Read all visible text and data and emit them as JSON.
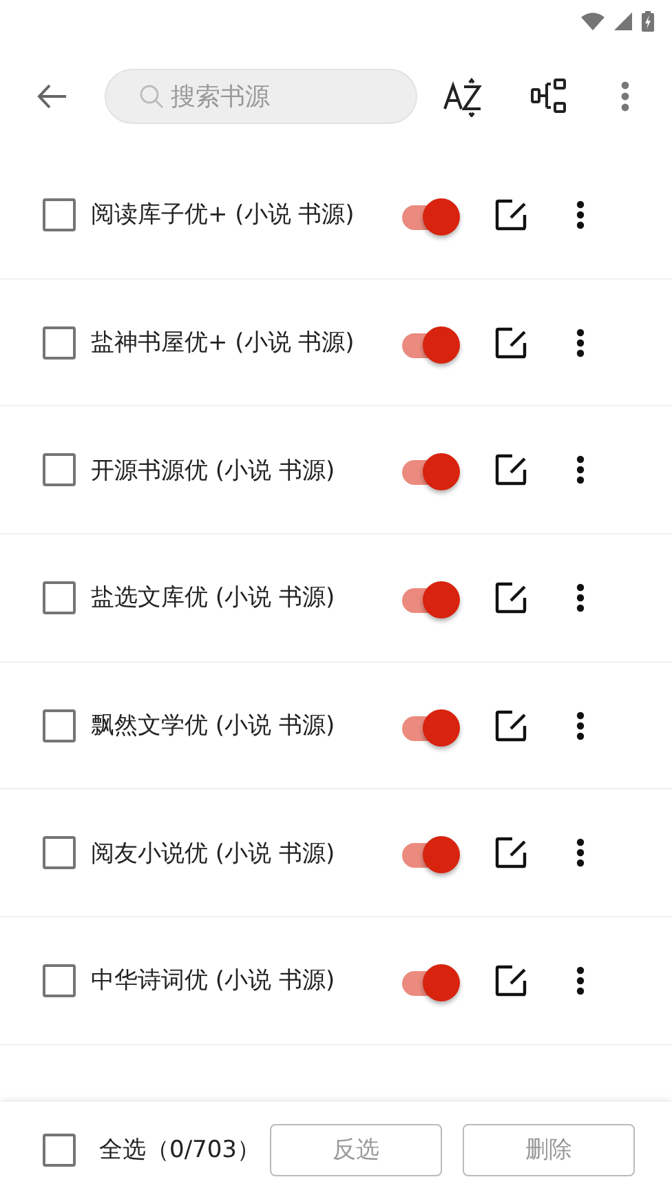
{
  "toolbar": {
    "search": {
      "placeholder": "搜索书源"
    }
  },
  "sources": [
    {
      "name": "阅读库子优+ (小说 书源)",
      "checked": false,
      "on": true
    },
    {
      "name": "盐神书屋优+ (小说 书源)",
      "checked": false,
      "on": true
    },
    {
      "name": "开源书源优 (小说 书源)",
      "checked": false,
      "on": true
    },
    {
      "name": "盐选文库优 (小说 书源)",
      "checked": false,
      "on": true
    },
    {
      "name": "飘然文学优 (小说 书源)",
      "checked": false,
      "on": true
    },
    {
      "name": "阅友小说优 (小说 书源)",
      "checked": false,
      "on": true
    },
    {
      "name": "中华诗词优 (小说 书源)",
      "checked": false,
      "on": true
    }
  ],
  "bottom_bar": {
    "select_all": {
      "label": "全选（0/703）",
      "checked": false
    },
    "buttons": [
      "反选",
      "删除"
    ]
  }
}
